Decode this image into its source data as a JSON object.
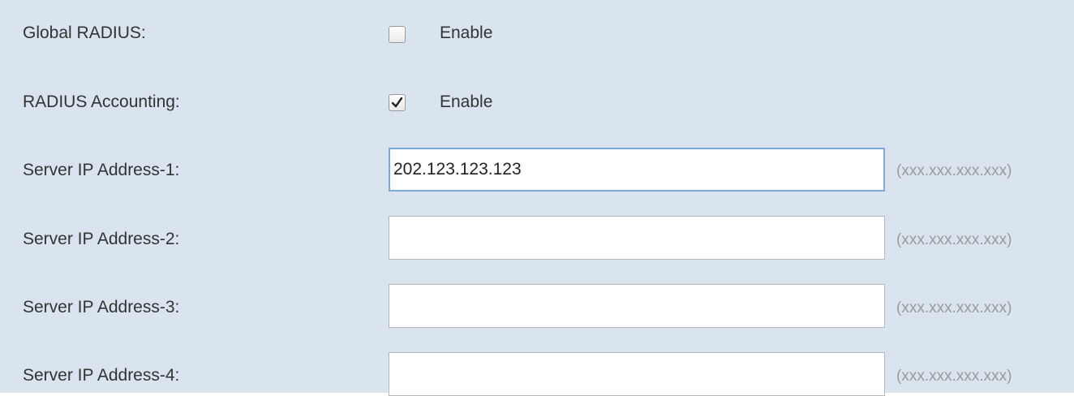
{
  "form": {
    "global_radius": {
      "label": "Global RADIUS:",
      "checkbox_label": "Enable",
      "checked": false
    },
    "radius_accounting": {
      "label": "RADIUS Accounting:",
      "checkbox_label": "Enable",
      "checked": true
    },
    "servers": [
      {
        "label": "Server IP Address-1:",
        "value": "202.123.123.123",
        "hint": "(xxx.xxx.xxx.xxx)"
      },
      {
        "label": "Server IP Address-2:",
        "value": "",
        "hint": "(xxx.xxx.xxx.xxx)"
      },
      {
        "label": "Server IP Address-3:",
        "value": "",
        "hint": "(xxx.xxx.xxx.xxx)"
      },
      {
        "label": "Server IP Address-4:",
        "value": "",
        "hint": "(xxx.xxx.xxx.xxx)"
      }
    ]
  },
  "icons": {
    "checkmark": "checkmark-icon"
  },
  "colors": {
    "panel_background": "#d9e4ef",
    "focus_border": "#7da8d8",
    "hint_text": "#9a9a9a"
  }
}
